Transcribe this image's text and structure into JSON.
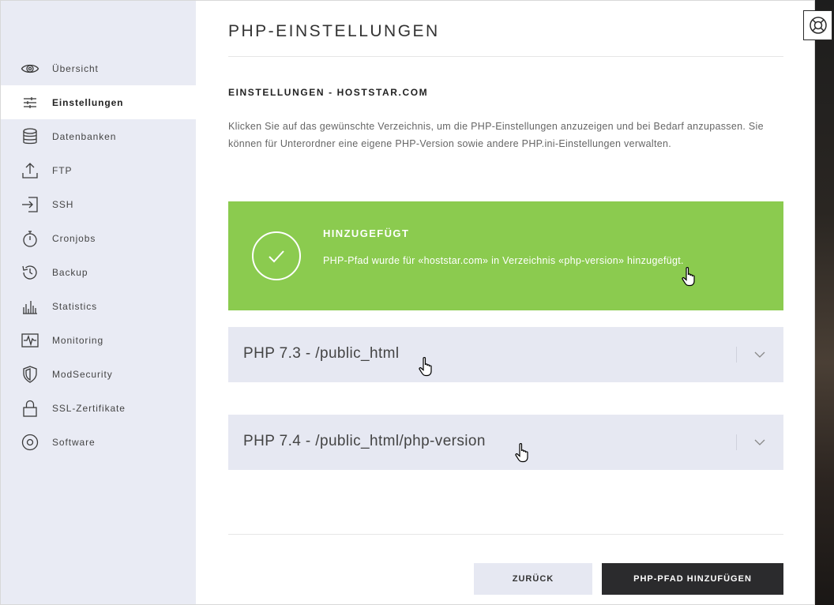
{
  "sidebar": {
    "items": [
      {
        "label": "Übersicht",
        "icon": "eye-icon",
        "active": false
      },
      {
        "label": "Einstellungen",
        "icon": "sliders-icon",
        "active": true
      },
      {
        "label": "Datenbanken",
        "icon": "database-icon",
        "active": false
      },
      {
        "label": "FTP",
        "icon": "upload-icon",
        "active": false
      },
      {
        "label": "SSH",
        "icon": "login-icon",
        "active": false
      },
      {
        "label": "Cronjobs",
        "icon": "stopwatch-icon",
        "active": false
      },
      {
        "label": "Backup",
        "icon": "history-icon",
        "active": false
      },
      {
        "label": "Statistics",
        "icon": "bar-chart-icon",
        "active": false
      },
      {
        "label": "Monitoring",
        "icon": "pulse-icon",
        "active": false
      },
      {
        "label": "ModSecurity",
        "icon": "shield-icon",
        "active": false
      },
      {
        "label": "SSL-Zertifikate",
        "icon": "lock-icon",
        "active": false
      },
      {
        "label": "Software",
        "icon": "disc-icon",
        "active": false
      }
    ]
  },
  "main": {
    "title": "PHP-EINSTELLUNGEN",
    "section_title": "EINSTELLUNGEN - HOSTSTAR.COM",
    "description": "Klicken Sie auf das gewünschte Verzeichnis, um die PHP-Einstellungen anzuzeigen und bei Bedarf anzupassen. Sie können für Unterordner eine eigene PHP-Version sowie andere PHP.ini-Einstellungen verwalten.",
    "alert": {
      "title": "HINZUGEFÜGT",
      "text": "PHP-Pfad wurde für «hoststar.com» in Verzeichnis «php-version» hinzugefügt.",
      "icon": "checkmark-circle-icon",
      "color": "#8bcb4f"
    },
    "paths": [
      {
        "label": "PHP 7.3 - /public_html"
      },
      {
        "label": "PHP 7.4 - /public_html/php-version"
      }
    ],
    "buttons": {
      "back": "ZURÜCK",
      "add": "PHP-PFAD HINZUFÜGEN"
    }
  },
  "help": {
    "icon": "lifebuoy-icon"
  },
  "colors": {
    "sidebar_bg": "#e9ebf4",
    "accent_success": "#8bcb4f",
    "primary_button": "#2b2b2d",
    "row_bg": "#e6e8f2"
  }
}
